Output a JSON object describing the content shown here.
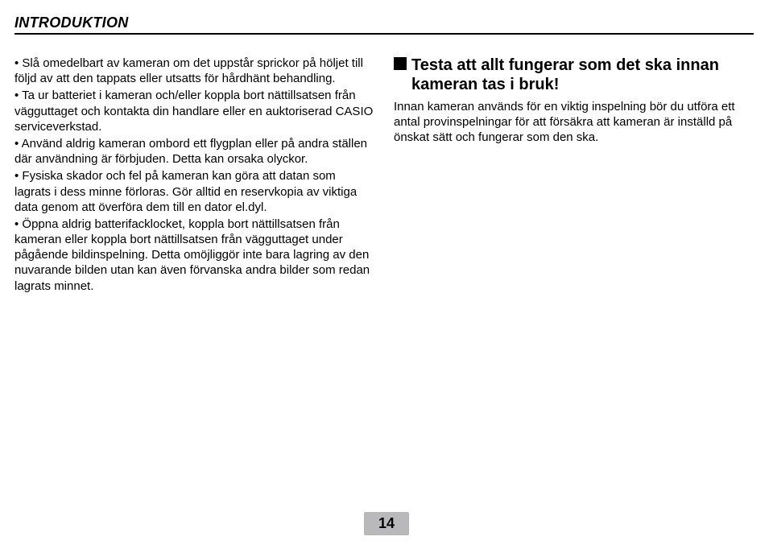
{
  "header": {
    "title": "INTRODUKTION"
  },
  "left": {
    "bullets": [
      "Slå omedelbart av kameran om det uppstår sprickor på höljet till följd av att den tappats eller utsatts för hårdhänt behandling.",
      "Ta ur batteriet i kameran och/eller koppla bort nättillsatsen från vägguttaget och kontakta din handlare eller en auktoriserad CASIO serviceverkstad.",
      "Använd aldrig kameran ombord ett flygplan eller på andra ställen där användning är förbjuden. Detta kan orsaka olyckor.",
      "Fysiska skador och fel på kameran kan göra att datan som lagrats i dess minne förloras. Gör alltid en reservkopia av viktiga data genom att överföra dem till en dator el.dyl.",
      "Öppna aldrig batterifacklocket, koppla bort nättillsatsen från kameran eller koppla bort nättillsatsen från vägguttaget under pågående bildinspelning. Detta omöjliggör inte bara lagring av den nuvarande bilden utan kan även förvanska andra bilder som redan lagrats minnet."
    ]
  },
  "right": {
    "heading_line1": "Testa att allt fungerar som det ska innan",
    "heading_line2": "kameran tas i bruk!",
    "body": "Innan kameran används för en viktig inspelning bör du utföra ett antal provinspelningar för att försäkra att kameran är inställd på önskat sätt och fungerar som den ska."
  },
  "page_number": "14"
}
